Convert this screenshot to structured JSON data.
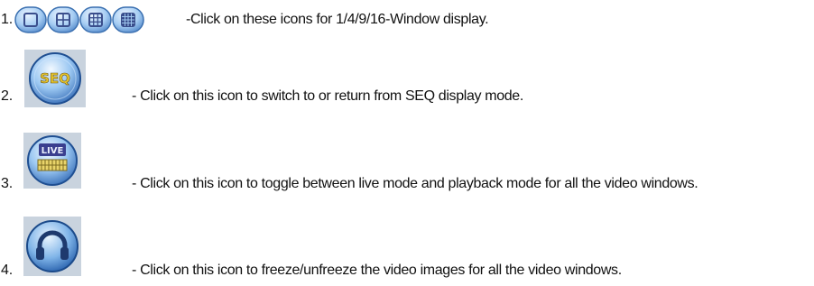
{
  "items": [
    {
      "number": "1.",
      "text": "-Click on these icons for 1/4/9/16-Window display.",
      "icons": [
        "single-window-icon",
        "quad-window-icon",
        "nine-window-icon",
        "sixteen-window-icon"
      ]
    },
    {
      "number": "2.",
      "text": "- Click on this icon to switch to or return from SEQ display mode.",
      "icon": "seq-icon",
      "icon_text": "SEQ"
    },
    {
      "number": "3.",
      "text": "- Click on this icon to toggle between live mode and playback mode for all the video windows.",
      "icon": "live-icon",
      "icon_text": "LIVE"
    },
    {
      "number": "4.",
      "text": "-  Click on this icon to freeze/unfreeze the video images for all the video windows.",
      "icon": "headphones-icon"
    }
  ],
  "colors": {
    "button_fill": "#9fc6ee",
    "button_border": "#3a6fb0",
    "button_glyph": "#3a4e8c",
    "seq_text": "#e7c62e"
  }
}
